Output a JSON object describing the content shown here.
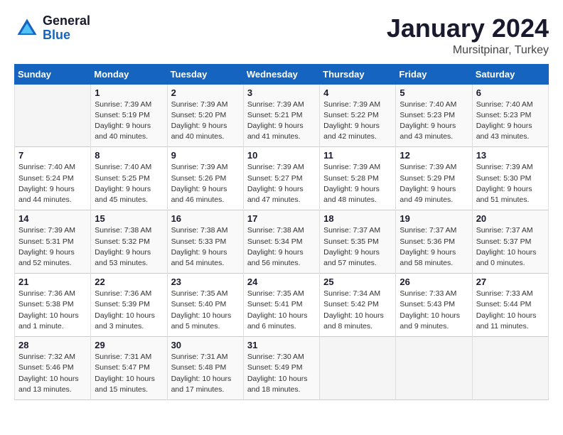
{
  "logo": {
    "general": "General",
    "blue": "Blue"
  },
  "title": "January 2024",
  "location": "Mursitpinar, Turkey",
  "days_of_week": [
    "Sunday",
    "Monday",
    "Tuesday",
    "Wednesday",
    "Thursday",
    "Friday",
    "Saturday"
  ],
  "weeks": [
    [
      {
        "day": "",
        "info": ""
      },
      {
        "day": "1",
        "info": "Sunrise: 7:39 AM\nSunset: 5:19 PM\nDaylight: 9 hours\nand 40 minutes."
      },
      {
        "day": "2",
        "info": "Sunrise: 7:39 AM\nSunset: 5:20 PM\nDaylight: 9 hours\nand 40 minutes."
      },
      {
        "day": "3",
        "info": "Sunrise: 7:39 AM\nSunset: 5:21 PM\nDaylight: 9 hours\nand 41 minutes."
      },
      {
        "day": "4",
        "info": "Sunrise: 7:39 AM\nSunset: 5:22 PM\nDaylight: 9 hours\nand 42 minutes."
      },
      {
        "day": "5",
        "info": "Sunrise: 7:40 AM\nSunset: 5:23 PM\nDaylight: 9 hours\nand 43 minutes."
      },
      {
        "day": "6",
        "info": "Sunrise: 7:40 AM\nSunset: 5:23 PM\nDaylight: 9 hours\nand 43 minutes."
      }
    ],
    [
      {
        "day": "7",
        "info": "Sunrise: 7:40 AM\nSunset: 5:24 PM\nDaylight: 9 hours\nand 44 minutes."
      },
      {
        "day": "8",
        "info": "Sunrise: 7:40 AM\nSunset: 5:25 PM\nDaylight: 9 hours\nand 45 minutes."
      },
      {
        "day": "9",
        "info": "Sunrise: 7:39 AM\nSunset: 5:26 PM\nDaylight: 9 hours\nand 46 minutes."
      },
      {
        "day": "10",
        "info": "Sunrise: 7:39 AM\nSunset: 5:27 PM\nDaylight: 9 hours\nand 47 minutes."
      },
      {
        "day": "11",
        "info": "Sunrise: 7:39 AM\nSunset: 5:28 PM\nDaylight: 9 hours\nand 48 minutes."
      },
      {
        "day": "12",
        "info": "Sunrise: 7:39 AM\nSunset: 5:29 PM\nDaylight: 9 hours\nand 49 minutes."
      },
      {
        "day": "13",
        "info": "Sunrise: 7:39 AM\nSunset: 5:30 PM\nDaylight: 9 hours\nand 51 minutes."
      }
    ],
    [
      {
        "day": "14",
        "info": "Sunrise: 7:39 AM\nSunset: 5:31 PM\nDaylight: 9 hours\nand 52 minutes."
      },
      {
        "day": "15",
        "info": "Sunrise: 7:38 AM\nSunset: 5:32 PM\nDaylight: 9 hours\nand 53 minutes."
      },
      {
        "day": "16",
        "info": "Sunrise: 7:38 AM\nSunset: 5:33 PM\nDaylight: 9 hours\nand 54 minutes."
      },
      {
        "day": "17",
        "info": "Sunrise: 7:38 AM\nSunset: 5:34 PM\nDaylight: 9 hours\nand 56 minutes."
      },
      {
        "day": "18",
        "info": "Sunrise: 7:37 AM\nSunset: 5:35 PM\nDaylight: 9 hours\nand 57 minutes."
      },
      {
        "day": "19",
        "info": "Sunrise: 7:37 AM\nSunset: 5:36 PM\nDaylight: 9 hours\nand 58 minutes."
      },
      {
        "day": "20",
        "info": "Sunrise: 7:37 AM\nSunset: 5:37 PM\nDaylight: 10 hours\nand 0 minutes."
      }
    ],
    [
      {
        "day": "21",
        "info": "Sunrise: 7:36 AM\nSunset: 5:38 PM\nDaylight: 10 hours\nand 1 minute."
      },
      {
        "day": "22",
        "info": "Sunrise: 7:36 AM\nSunset: 5:39 PM\nDaylight: 10 hours\nand 3 minutes."
      },
      {
        "day": "23",
        "info": "Sunrise: 7:35 AM\nSunset: 5:40 PM\nDaylight: 10 hours\nand 5 minutes."
      },
      {
        "day": "24",
        "info": "Sunrise: 7:35 AM\nSunset: 5:41 PM\nDaylight: 10 hours\nand 6 minutes."
      },
      {
        "day": "25",
        "info": "Sunrise: 7:34 AM\nSunset: 5:42 PM\nDaylight: 10 hours\nand 8 minutes."
      },
      {
        "day": "26",
        "info": "Sunrise: 7:33 AM\nSunset: 5:43 PM\nDaylight: 10 hours\nand 9 minutes."
      },
      {
        "day": "27",
        "info": "Sunrise: 7:33 AM\nSunset: 5:44 PM\nDaylight: 10 hours\nand 11 minutes."
      }
    ],
    [
      {
        "day": "28",
        "info": "Sunrise: 7:32 AM\nSunset: 5:46 PM\nDaylight: 10 hours\nand 13 minutes."
      },
      {
        "day": "29",
        "info": "Sunrise: 7:31 AM\nSunset: 5:47 PM\nDaylight: 10 hours\nand 15 minutes."
      },
      {
        "day": "30",
        "info": "Sunrise: 7:31 AM\nSunset: 5:48 PM\nDaylight: 10 hours\nand 17 minutes."
      },
      {
        "day": "31",
        "info": "Sunrise: 7:30 AM\nSunset: 5:49 PM\nDaylight: 10 hours\nand 18 minutes."
      },
      {
        "day": "",
        "info": ""
      },
      {
        "day": "",
        "info": ""
      },
      {
        "day": "",
        "info": ""
      }
    ]
  ]
}
